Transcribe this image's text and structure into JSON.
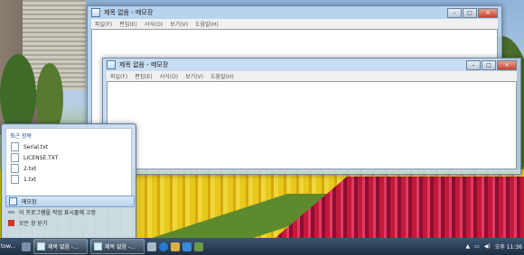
{
  "windows": [
    {
      "title": "제목 없음 - 메모장",
      "menu": [
        "파일(F)",
        "편집(E)",
        "서식(O)",
        "보기(V)",
        "도움말(H)"
      ]
    },
    {
      "title": "제목 없음 - 메모장",
      "menu": [
        "파일(F)",
        "편집(E)",
        "서식(O)",
        "보기(V)",
        "도움말(H)"
      ]
    }
  ],
  "jumplist": {
    "header": "최근 항목",
    "recent": [
      "Serial.txt",
      "LICENSE.TXT",
      "2.txt",
      "1.txt"
    ],
    "tasks": [
      "메모장",
      "이 프로그램을 작업 표시줄에 고정",
      "모든 창 닫기"
    ]
  },
  "taskbar": {
    "start_label": "tow...",
    "buttons": [
      "제목 없음 -...",
      "제목 없음 -..."
    ],
    "clock": "오후 11:36"
  }
}
